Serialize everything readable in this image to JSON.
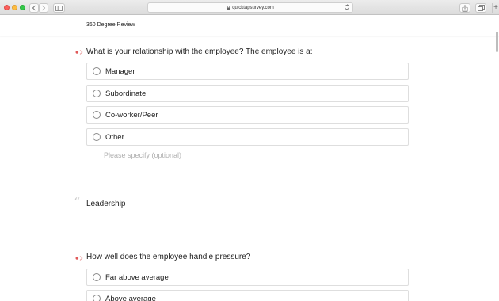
{
  "browser": {
    "url": "quicktapsurvey.com",
    "new_tab_symbol": "+"
  },
  "header": {
    "title": "360 Degree Review"
  },
  "questions": [
    {
      "title": "What is your relationship with the employee? The employee is a:",
      "required": true,
      "options": [
        "Manager",
        "Subordinate",
        "Co-worker/Peer",
        "Other"
      ],
      "other_placeholder": "Please specify (optional)"
    },
    {
      "title": "How well does the employee handle pressure?",
      "required": true,
      "options": [
        "Far above average",
        "Above average"
      ]
    }
  ],
  "section": {
    "title": "Leadership",
    "icon": "quote-icon"
  },
  "colors": {
    "required_marker": "#e05a5a",
    "border": "#dedede",
    "placeholder": "#b0b0b0"
  }
}
